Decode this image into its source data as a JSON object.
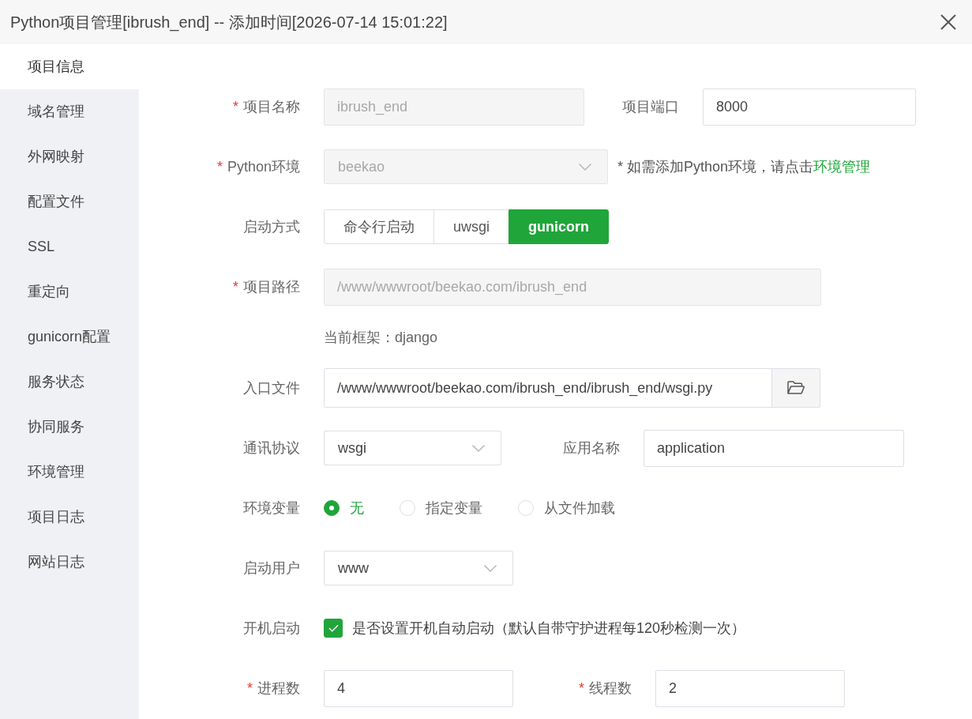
{
  "window": {
    "title": "Python项目管理[ibrush_end] -- 添加时间[2026-07-14 15:01:22]"
  },
  "sidebar": {
    "items": [
      {
        "label": "项目信息",
        "selected": true
      },
      {
        "label": "域名管理",
        "selected": false
      },
      {
        "label": "外网映射",
        "selected": false
      },
      {
        "label": "配置文件",
        "selected": false
      },
      {
        "label": "SSL",
        "selected": false
      },
      {
        "label": "重定向",
        "selected": false
      },
      {
        "label": "gunicorn配置",
        "selected": false
      },
      {
        "label": "服务状态",
        "selected": false
      },
      {
        "label": "协同服务",
        "selected": false
      },
      {
        "label": "环境管理",
        "selected": false
      },
      {
        "label": "项目日志",
        "selected": false
      },
      {
        "label": "网站日志",
        "selected": false
      }
    ]
  },
  "form": {
    "rows": [
      {
        "fields": [
          {
            "kind": "input",
            "required_mark": "*",
            "label": "项目名称",
            "value": "ibrush_end",
            "disabled": true
          },
          {
            "kind": "input",
            "label": "项目端口",
            "value": "8000",
            "disabled": false
          }
        ]
      },
      {
        "fields": [
          {
            "kind": "select",
            "required_mark": "*",
            "label": "Python环境",
            "value": "beekao",
            "disabled": true
          }
        ],
        "hint": {
          "text": "* 如需添加Python环境，请点击",
          "link": "环境管理"
        }
      },
      {
        "fields": [
          {
            "kind": "segmented",
            "label": "启动方式",
            "options": [
              {
                "label": "命令行启动",
                "selected": false
              },
              {
                "label": "uwsgi",
                "selected": false
              },
              {
                "label": "gunicorn",
                "selected": true
              }
            ]
          }
        ]
      },
      {
        "fields": [
          {
            "kind": "input",
            "required_mark": "*",
            "label": "项目路径",
            "value": "/www/wwwroot/beekao.com/ibrush_end",
            "disabled": true
          }
        ]
      },
      {
        "fields": [
          {
            "kind": "note",
            "text": "当前框架：django"
          }
        ]
      },
      {
        "fields": [
          {
            "kind": "file",
            "label": "入口文件",
            "value": "/www/wwwroot/beekao.com/ibrush_end/ibrush_end/wsgi.py",
            "disabled": false
          }
        ]
      },
      {
        "fields": [
          {
            "kind": "select",
            "label": "通讯协议",
            "value": "wsgi",
            "disabled": false
          },
          {
            "kind": "input",
            "label": "应用名称",
            "value": "application",
            "disabled": false
          }
        ]
      },
      {
        "fields": [
          {
            "kind": "radios",
            "label": "环境变量",
            "options": [
              {
                "label": "无",
                "selected": true
              },
              {
                "label": "指定变量",
                "selected": false
              },
              {
                "label": "从文件加载",
                "selected": false
              }
            ]
          }
        ]
      },
      {
        "fields": [
          {
            "kind": "select",
            "label": "启动用户",
            "value": "www",
            "disabled": false
          }
        ]
      },
      {
        "fields": [
          {
            "kind": "checkbox",
            "label": "开机启动",
            "text": "是否设置开机自动启动（默认自带守护进程每120秒检测一次）",
            "checked": true
          }
        ]
      },
      {
        "fields": [
          {
            "kind": "input",
            "required_mark": "*",
            "label": "进程数",
            "value": "4",
            "disabled": false
          },
          {
            "kind": "input",
            "required_mark": "*",
            "label": "线程数",
            "value": "2",
            "disabled": false
          }
        ]
      }
    ]
  }
}
